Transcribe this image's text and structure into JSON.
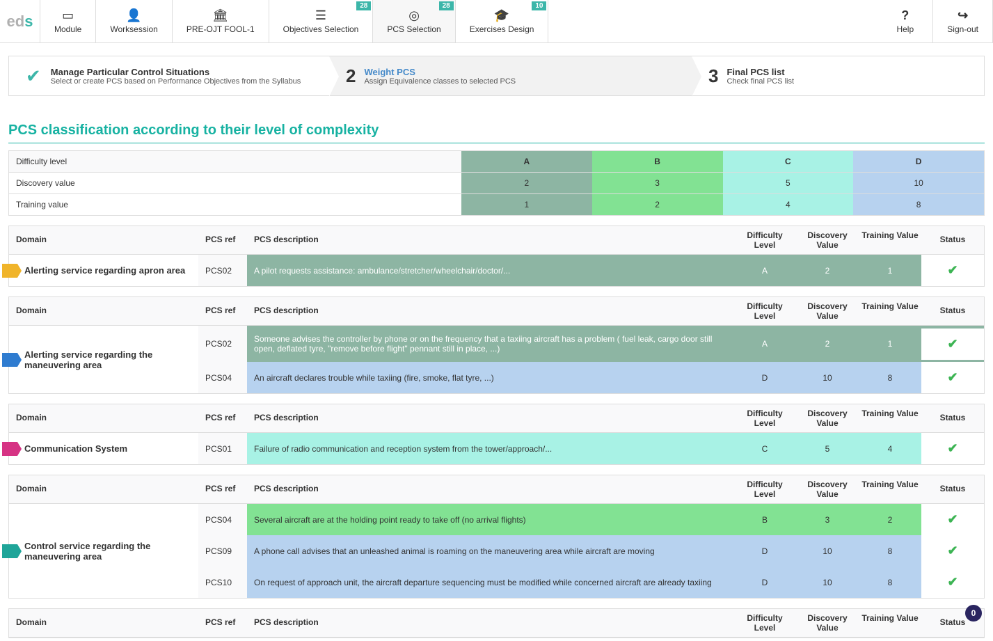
{
  "logo": {
    "text1": "ed",
    "dot": "s"
  },
  "nav": [
    {
      "icon": "book-icon",
      "label": "Module"
    },
    {
      "icon": "person-icon",
      "label": "Worksession"
    },
    {
      "icon": "institution-icon",
      "label": "PRE-OJT FOOL-1"
    },
    {
      "icon": "list-icon",
      "label": "Objectives Selection",
      "badge": "28"
    },
    {
      "icon": "target-icon",
      "label": "PCS Selection",
      "badge": "28",
      "active": true
    },
    {
      "icon": "graduation-icon",
      "label": "Exercises Design",
      "badge": "10"
    }
  ],
  "nav_right": [
    {
      "icon": "help-icon",
      "label": "Help"
    },
    {
      "icon": "signout-icon",
      "label": "Sign-out"
    }
  ],
  "wizard": [
    {
      "state": "done",
      "title": "Manage Particular Control Situations",
      "sub": "Select or create PCS based on Performance Objectives from the Syllabus"
    },
    {
      "state": "active",
      "num": "2",
      "title": "Weight PCS",
      "sub": "Assign Equivalence classes to selected PCS"
    },
    {
      "state": "future",
      "num": "3",
      "title": "Final PCS list",
      "sub": "Check final PCS list"
    }
  ],
  "section_title": "PCS classification according to their level of complexity",
  "summary": {
    "rows": [
      {
        "label": "Difficulty level",
        "values": [
          "A",
          "B",
          "C",
          "D"
        ]
      },
      {
        "label": "Discovery value",
        "values": [
          "2",
          "3",
          "5",
          "10"
        ]
      },
      {
        "label": "Training value",
        "values": [
          "1",
          "2",
          "4",
          "8"
        ]
      }
    ]
  },
  "columns": {
    "domain": "Domain",
    "ref": "PCS ref",
    "desc": "PCS description",
    "lvl": "Difficulty Level",
    "dv": "Discovery Value",
    "tv": "Training Value",
    "status": "Status"
  },
  "groups": [
    {
      "flag_color": "#f0b42a",
      "domain": "Alerting service regarding apron area",
      "rows": [
        {
          "ref": "PCS02",
          "desc": "A pilot requests assistance: ambulance/stretcher/wheelchair/doctor/...",
          "lvl": "A",
          "dv": "2",
          "tv": "1",
          "status": "ok"
        }
      ]
    },
    {
      "flag_color": "#2f7cd0",
      "domain": "Alerting service regarding the maneuvering area",
      "rows": [
        {
          "ref": "PCS02",
          "desc": "Someone advises the controller by phone or on the frequency that a taxiing aircraft has a problem ( fuel leak, cargo door still open, deflated tyre, \"remove before flight\" pennant still in place, ...)",
          "lvl": "A",
          "dv": "2",
          "tv": "1",
          "status": "ok"
        },
        {
          "ref": "PCS04",
          "desc": "An aircraft declares trouble while taxiing (fire, smoke, flat tyre, ...)",
          "lvl": "D",
          "dv": "10",
          "tv": "8",
          "status": "ok"
        }
      ]
    },
    {
      "flag_color": "#d63384",
      "domain": "Communication System",
      "rows": [
        {
          "ref": "PCS01",
          "desc": "Failure of radio communication and reception system from the tower/approach/...",
          "lvl": "C",
          "dv": "5",
          "tv": "4",
          "status": "ok"
        }
      ]
    },
    {
      "flag_color": "#1fa599",
      "domain": "Control service regarding the maneuvering area",
      "rows": [
        {
          "ref": "PCS04",
          "desc": "Several aircraft are at the holding point ready to take off (no arrival flights)",
          "lvl": "B",
          "dv": "3",
          "tv": "2",
          "status": "ok"
        },
        {
          "ref": "PCS09",
          "desc": "A phone call advises that an unleashed animal is roaming on the maneuvering area while aircraft are moving",
          "lvl": "D",
          "dv": "10",
          "tv": "8",
          "status": "ok"
        },
        {
          "ref": "PCS10",
          "desc": "On request of approach unit, the aircraft departure sequencing must be modified while concerned aircraft are already taxiing",
          "lvl": "D",
          "dv": "10",
          "tv": "8",
          "status": "ok"
        }
      ]
    },
    {
      "flag_color": "#888",
      "domain": "",
      "rows": []
    }
  ],
  "float_badge": "0"
}
